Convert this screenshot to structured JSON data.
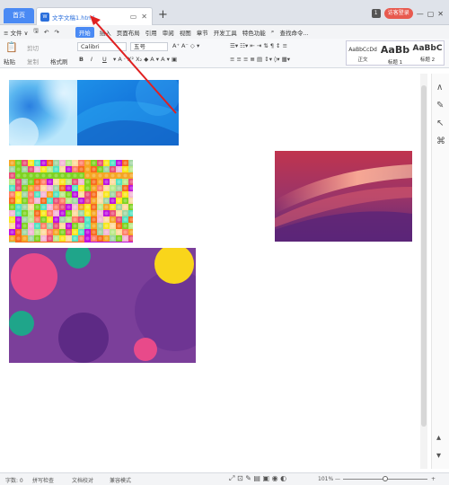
{
  "tabs": {
    "home": "首页",
    "document": "文字文稿1.html",
    "doc_icon": "W",
    "new_tab": "+",
    "login": "访客登录",
    "badge": "1"
  },
  "menu": {
    "file": "≡ 文件 ∨",
    "items": [
      "开始",
      "插入",
      "页面布局",
      "引用",
      "审阅",
      "视图",
      "章节",
      "开发工具",
      "特色功能"
    ],
    "search": "查找命令..."
  },
  "ribbon": {
    "paste": "粘贴",
    "cut": "剪切",
    "copy": "复制",
    "format_painter": "格式刷",
    "font_name": "Calibri",
    "font_size": "五号",
    "bold": "B",
    "italic": "I",
    "underline": "U",
    "styles": [
      {
        "preview": "AaBbCcDd",
        "name": "正文"
      },
      {
        "preview": "AaBb",
        "name": "标题 1"
      },
      {
        "preview": "AaBbC",
        "name": "标题 2"
      }
    ]
  },
  "status": {
    "word_count": "字数: 0",
    "spell_check": "拼写检查",
    "doc_compare": "文档校对",
    "compat_mode": "兼容模式",
    "zoom": "101%"
  },
  "colors": {
    "accent": "#4a8af4",
    "login": "#e85a4f",
    "arrow": "#e02020"
  }
}
